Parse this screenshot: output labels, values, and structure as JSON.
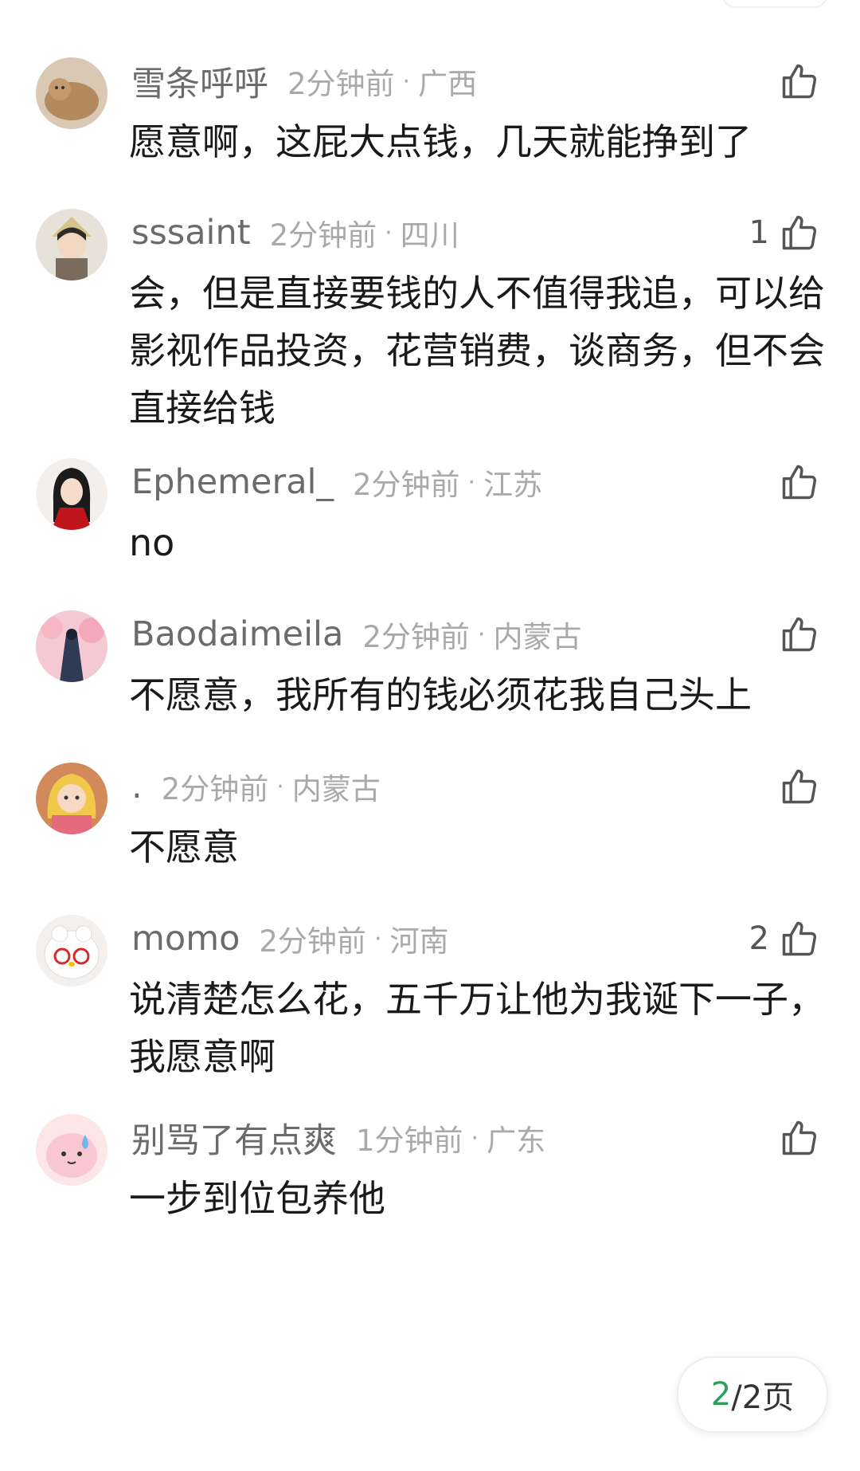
{
  "comments": [
    {
      "user": "雪条呼呼",
      "time": "2分钟前",
      "dot": "·",
      "location": "广西",
      "likes": "",
      "text": "愿意啊，这屁大点钱，几天就能挣到了"
    },
    {
      "user": "sssaint",
      "time": "2分钟前",
      "dot": "·",
      "location": "四川",
      "likes": "1",
      "text": "会，但是直接要钱的人不值得我追，可以给影视作品投资，花营销费，谈商务，但不会直接给钱"
    },
    {
      "user": "Ephemeral_",
      "time": "2分钟前",
      "dot": "·",
      "location": "江苏",
      "likes": "",
      "text": "no"
    },
    {
      "user": "Baodaimeila",
      "time": "2分钟前",
      "dot": "·",
      "location": "内蒙古",
      "likes": "",
      "text": "不愿意，我所有的钱必须花我自己头上"
    },
    {
      "user": ".",
      "time": "2分钟前",
      "dot": "·",
      "location": "内蒙古",
      "likes": "",
      "text": "不愿意"
    },
    {
      "user": "momo",
      "time": "2分钟前",
      "dot": "·",
      "location": "河南",
      "likes": "2",
      "text": "说清楚怎么花，五千万让他为我诞下一子，我愿意啊"
    },
    {
      "user": "别骂了有点爽",
      "time": "1分钟前",
      "dot": "·",
      "location": "广东",
      "likes": "",
      "text": "一步到位包养他"
    }
  ],
  "pager": {
    "current": "2",
    "total": "/2页"
  },
  "icons": {
    "like": "thumbs-up-icon"
  }
}
